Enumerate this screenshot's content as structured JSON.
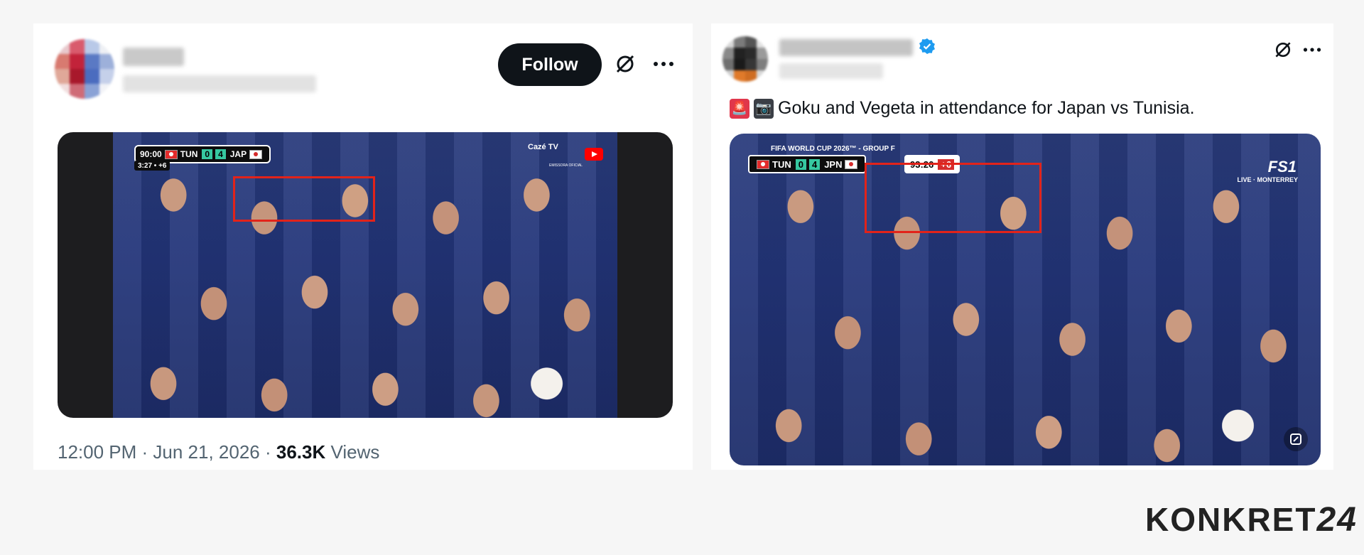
{
  "left_post": {
    "follow_label": "Follow",
    "scorebug": {
      "time": "90:00",
      "added": "3:27 • +6",
      "team1": "TUN",
      "score1": "0",
      "score2": "4",
      "team2": "JAP",
      "broadcaster": "Cazé TV",
      "badge": "EMISSORA OFICIAL"
    },
    "timestamp": "12:00 PM · Jun 21, 2026 · ",
    "views_count": "36.3K",
    "views_label": "Views"
  },
  "right_post": {
    "tweet_text": "Goku and Vegeta in attendance for Japan vs Tunisia.",
    "emojis": [
      "🚨",
      "📷"
    ],
    "scorebug": {
      "competition": "FIFA WORLD CUP 2026™ - GROUP F",
      "team1": "TUN",
      "score1": "0",
      "score2": "4",
      "team2": "JPN",
      "clock": "93:26",
      "added": "+6",
      "channel": "FS1",
      "channel_sub": "LIVE · MONTERREY"
    }
  },
  "watermark": {
    "text": "KONKRET",
    "number": "24"
  },
  "colors": {
    "follow_bg": "#0f1419",
    "verified": "#1d9bf0",
    "highlight_box": "#e2231a",
    "score_bg": "#36c8a0"
  }
}
